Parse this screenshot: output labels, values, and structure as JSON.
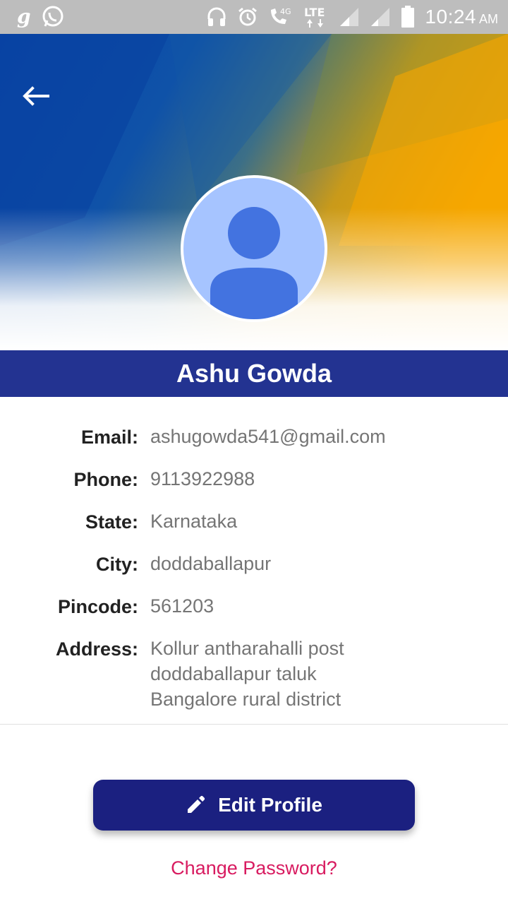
{
  "status_bar": {
    "time": "10:24",
    "ampm": "AM",
    "network_badge": "4G",
    "network_type": "LTE",
    "icons": [
      "g-app-icon",
      "whatsapp-icon",
      "headphones-icon",
      "alarm-icon",
      "call-4g-icon",
      "lte-icon",
      "signal-icon",
      "signal-icon",
      "battery-icon"
    ]
  },
  "header": {
    "back_icon": "arrow-left-icon",
    "avatar_icon": "person-icon",
    "colors": {
      "blue": "#0e4aa6",
      "orange": "#f6a800"
    }
  },
  "profile": {
    "name": "Ashu Gowda",
    "fields": [
      {
        "label": "Email:",
        "value": "ashugowda541@gmail.com"
      },
      {
        "label": "Phone:",
        "value": "9113922988"
      },
      {
        "label": "State:",
        "value": "Karnataka"
      },
      {
        "label": "City:",
        "value": "doddaballapur"
      },
      {
        "label": "Pincode:",
        "value": "561203"
      }
    ],
    "address": {
      "label": "Address:",
      "lines": [
        "Kollur antharahalli post",
        "doddaballapur taluk",
        "Bangalore rural district"
      ]
    }
  },
  "actions": {
    "edit_label": "Edit Profile",
    "edit_icon": "pencil-icon",
    "change_password": "Change Password?"
  },
  "colors": {
    "name_bar": "#233391",
    "button": "#1b2080",
    "link": "#d81b60"
  }
}
